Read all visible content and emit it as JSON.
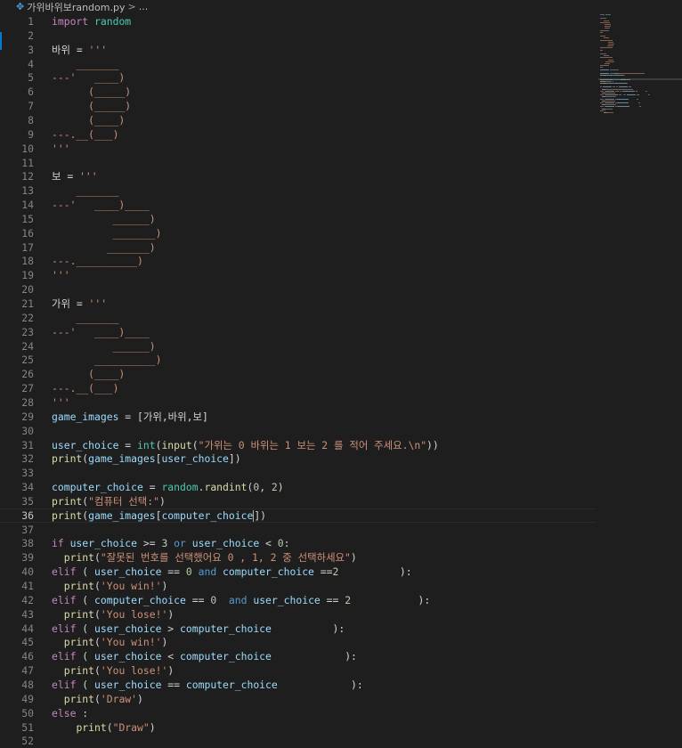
{
  "breadcrumb": {
    "icon": "python-file-icon",
    "filename": "가위바위보random.py",
    "separator": ">",
    "trailing": "..."
  },
  "editor": {
    "active_line": 36,
    "lines": [
      {
        "n": "1",
        "t": [
          [
            "kw",
            "import"
          ],
          [
            "p",
            " "
          ],
          [
            "mod",
            "random"
          ]
        ]
      },
      {
        "n": "2",
        "t": []
      },
      {
        "n": "3",
        "t": [
          [
            "p",
            "바위 = "
          ],
          [
            "str",
            "'''"
          ]
        ]
      },
      {
        "n": "4",
        "t": [
          [
            "str",
            "    _______"
          ]
        ]
      },
      {
        "n": "5",
        "t": [
          [
            "str",
            "---'   ____)"
          ]
        ]
      },
      {
        "n": "6",
        "t": [
          [
            "str",
            "      (_____)"
          ]
        ]
      },
      {
        "n": "7",
        "t": [
          [
            "str",
            "      (_____)"
          ]
        ]
      },
      {
        "n": "8",
        "t": [
          [
            "str",
            "      (____)"
          ]
        ]
      },
      {
        "n": "9",
        "t": [
          [
            "str",
            "---.__(___)"
          ]
        ]
      },
      {
        "n": "10",
        "t": [
          [
            "str",
            "'''"
          ]
        ]
      },
      {
        "n": "11",
        "t": []
      },
      {
        "n": "12",
        "t": [
          [
            "p",
            "보 = "
          ],
          [
            "str",
            "'''"
          ]
        ]
      },
      {
        "n": "13",
        "t": [
          [
            "str",
            "    _______"
          ]
        ]
      },
      {
        "n": "14",
        "t": [
          [
            "str",
            "---'   ____)____"
          ]
        ]
      },
      {
        "n": "15",
        "t": [
          [
            "str",
            "          ______)"
          ]
        ]
      },
      {
        "n": "16",
        "t": [
          [
            "str",
            "          _______)"
          ]
        ]
      },
      {
        "n": "17",
        "t": [
          [
            "str",
            "         _______)"
          ]
        ]
      },
      {
        "n": "18",
        "t": [
          [
            "str",
            "---.__________)"
          ]
        ]
      },
      {
        "n": "19",
        "t": [
          [
            "str",
            "'''"
          ]
        ]
      },
      {
        "n": "20",
        "t": []
      },
      {
        "n": "21",
        "t": [
          [
            "p",
            "가위 = "
          ],
          [
            "str",
            "'''"
          ]
        ]
      },
      {
        "n": "22",
        "t": [
          [
            "str",
            "    _______"
          ]
        ]
      },
      {
        "n": "23",
        "t": [
          [
            "str",
            "---'   ____)____"
          ]
        ]
      },
      {
        "n": "24",
        "t": [
          [
            "str",
            "          ______)"
          ]
        ]
      },
      {
        "n": "25",
        "t": [
          [
            "str",
            "       __________)"
          ]
        ]
      },
      {
        "n": "26",
        "t": [
          [
            "str",
            "      (____)"
          ]
        ]
      },
      {
        "n": "27",
        "t": [
          [
            "str",
            "---.__(___)"
          ]
        ]
      },
      {
        "n": "28",
        "t": [
          [
            "str",
            "'''"
          ]
        ]
      },
      {
        "n": "29",
        "t": [
          [
            "var",
            "game_images"
          ],
          [
            "p",
            " = [가위,바위,보]"
          ]
        ]
      },
      {
        "n": "30",
        "t": []
      },
      {
        "n": "31",
        "t": [
          [
            "var",
            "user_choice"
          ],
          [
            "p",
            " = "
          ],
          [
            "mod",
            "int"
          ],
          [
            "p",
            "("
          ],
          [
            "fn",
            "input"
          ],
          [
            "p",
            "("
          ],
          [
            "str",
            "\"가위는 0 바위는 1 보는 2 를 적어 주세요.\\n\""
          ],
          [
            "p",
            "))"
          ]
        ]
      },
      {
        "n": "32",
        "t": [
          [
            "fn",
            "print"
          ],
          [
            "p",
            "("
          ],
          [
            "var",
            "game_images"
          ],
          [
            "p",
            "["
          ],
          [
            "var",
            "user_choice"
          ],
          [
            "p",
            "])"
          ]
        ]
      },
      {
        "n": "33",
        "t": []
      },
      {
        "n": "34",
        "t": [
          [
            "var",
            "computer_choice"
          ],
          [
            "p",
            " = "
          ],
          [
            "mod",
            "random"
          ],
          [
            "p",
            "."
          ],
          [
            "fn",
            "randint"
          ],
          [
            "p",
            "("
          ],
          [
            "num",
            "0"
          ],
          [
            "p",
            ", "
          ],
          [
            "num",
            "2"
          ],
          [
            "p",
            ")"
          ]
        ]
      },
      {
        "n": "35",
        "t": [
          [
            "fn",
            "print"
          ],
          [
            "p",
            "("
          ],
          [
            "str",
            "\"컴퓨터 선택:\""
          ],
          [
            "p",
            ")"
          ]
        ]
      },
      {
        "n": "36",
        "t": [
          [
            "fn",
            "print"
          ],
          [
            "p",
            "("
          ],
          [
            "var",
            "game_images"
          ],
          [
            "p",
            "["
          ],
          [
            "var",
            "computer_choice"
          ],
          [
            "p",
            "])"
          ]
        ]
      },
      {
        "n": "37",
        "t": []
      },
      {
        "n": "38",
        "t": [
          [
            "kw",
            "if"
          ],
          [
            "p",
            " "
          ],
          [
            "var",
            "user_choice"
          ],
          [
            "p",
            " >= "
          ],
          [
            "num",
            "3"
          ],
          [
            "p",
            " "
          ],
          [
            "kwb",
            "or"
          ],
          [
            "p",
            " "
          ],
          [
            "var",
            "user_choice"
          ],
          [
            "p",
            " < "
          ],
          [
            "num",
            "0"
          ],
          [
            "p",
            ":"
          ]
        ]
      },
      {
        "n": "39",
        "t": [
          [
            "p",
            "  "
          ],
          [
            "fn",
            "print"
          ],
          [
            "p",
            "("
          ],
          [
            "str",
            "\"잘못된 번호를 선택했어요 0 , 1, 2 중 선택하세요\""
          ],
          [
            "p",
            ")"
          ]
        ]
      },
      {
        "n": "40",
        "t": [
          [
            "kw",
            "elif"
          ],
          [
            "p",
            " ( "
          ],
          [
            "var",
            "user_choice"
          ],
          [
            "p",
            " == "
          ],
          [
            "num",
            "0"
          ],
          [
            "p",
            " "
          ],
          [
            "kwb",
            "and"
          ],
          [
            "p",
            " "
          ],
          [
            "var",
            "computer_choice"
          ],
          [
            "p",
            " =="
          ],
          [
            "num",
            "2"
          ],
          [
            "p",
            "          ):"
          ]
        ]
      },
      {
        "n": "41",
        "t": [
          [
            "p",
            "  "
          ],
          [
            "fn",
            "print"
          ],
          [
            "p",
            "("
          ],
          [
            "str",
            "'You win!'"
          ],
          [
            "p",
            ")"
          ]
        ]
      },
      {
        "n": "42",
        "t": [
          [
            "kw",
            "elif"
          ],
          [
            "p",
            " ( "
          ],
          [
            "var",
            "computer_choice"
          ],
          [
            "p",
            " == "
          ],
          [
            "num",
            "0"
          ],
          [
            "p",
            "  "
          ],
          [
            "kwb",
            "and"
          ],
          [
            "p",
            " "
          ],
          [
            "var",
            "user_choice"
          ],
          [
            "p",
            " == "
          ],
          [
            "num",
            "2"
          ],
          [
            "p",
            "           ):"
          ]
        ]
      },
      {
        "n": "43",
        "t": [
          [
            "p",
            "  "
          ],
          [
            "fn",
            "print"
          ],
          [
            "p",
            "("
          ],
          [
            "str",
            "'You lose!'"
          ],
          [
            "p",
            ")"
          ]
        ]
      },
      {
        "n": "44",
        "t": [
          [
            "kw",
            "elif"
          ],
          [
            "p",
            " ( "
          ],
          [
            "var",
            "user_choice"
          ],
          [
            "p",
            " > "
          ],
          [
            "var",
            "computer_choice"
          ],
          [
            "p",
            "          ):"
          ]
        ]
      },
      {
        "n": "45",
        "t": [
          [
            "p",
            "  "
          ],
          [
            "fn",
            "print"
          ],
          [
            "p",
            "("
          ],
          [
            "str",
            "'You win!'"
          ],
          [
            "p",
            ")"
          ]
        ]
      },
      {
        "n": "46",
        "t": [
          [
            "kw",
            "elif"
          ],
          [
            "p",
            " ( "
          ],
          [
            "var",
            "user_choice"
          ],
          [
            "p",
            " < "
          ],
          [
            "var",
            "computer_choice"
          ],
          [
            "p",
            "            ):"
          ]
        ]
      },
      {
        "n": "47",
        "t": [
          [
            "p",
            "  "
          ],
          [
            "fn",
            "print"
          ],
          [
            "p",
            "("
          ],
          [
            "str",
            "'You lose!'"
          ],
          [
            "p",
            ")"
          ]
        ]
      },
      {
        "n": "48",
        "t": [
          [
            "kw",
            "elif"
          ],
          [
            "p",
            " ( "
          ],
          [
            "var",
            "user_choice"
          ],
          [
            "p",
            " == "
          ],
          [
            "var",
            "computer_choice"
          ],
          [
            "p",
            "            ):"
          ]
        ]
      },
      {
        "n": "49",
        "t": [
          [
            "p",
            "  "
          ],
          [
            "fn",
            "print"
          ],
          [
            "p",
            "("
          ],
          [
            "str",
            "'Draw'"
          ],
          [
            "p",
            ")"
          ]
        ]
      },
      {
        "n": "50",
        "t": [
          [
            "kw",
            "else"
          ],
          [
            "p",
            " :"
          ]
        ]
      },
      {
        "n": "51",
        "t": [
          [
            "p",
            "    "
          ],
          [
            "fn",
            "print"
          ],
          [
            "p",
            "("
          ],
          [
            "str",
            "\"Draw\""
          ],
          [
            "p",
            ")"
          ]
        ]
      },
      {
        "n": "52",
        "t": []
      }
    ]
  },
  "colors": {
    "background": "#1e1e1e",
    "keyword": "#c586c0",
    "keyword_blue": "#569cd6",
    "type": "#4ec9b0",
    "function": "#dcdcaa",
    "string": "#ce9178",
    "number": "#b5cea8",
    "variable": "#9cdcfe"
  }
}
